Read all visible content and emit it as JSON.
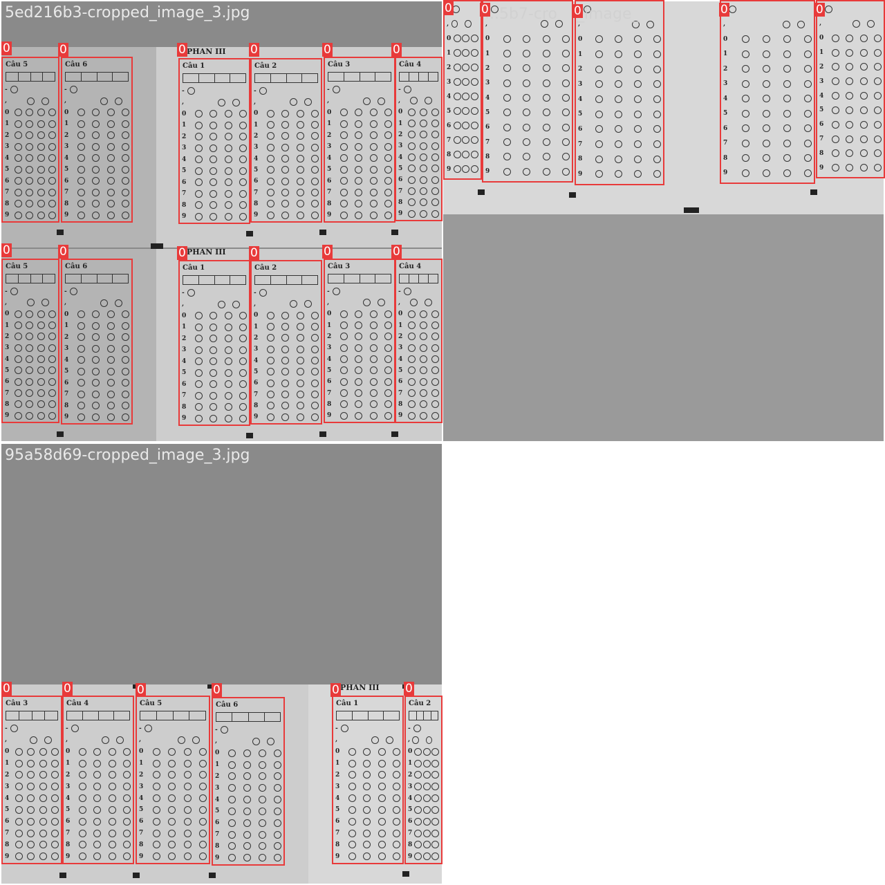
{
  "tiles": [
    {
      "title": "5ed216b3-cropped_image_3.jpg"
    },
    {
      "title": ""
    },
    {
      "title": "95a58d69-cropped_image_3.jpg"
    }
  ],
  "detection_label": "0",
  "header_label": "PHAN III",
  "columns": [
    "Câu 1",
    "Câu 2",
    "Câu 3",
    "Câu 4",
    "Câu 5",
    "Câu 6"
  ],
  "row_digits": [
    "0",
    "1",
    "2",
    "3",
    "4",
    "5",
    "6",
    "7",
    "8",
    "9"
  ],
  "symbols": {
    "minus": "-",
    "comma": ","
  },
  "colors": {
    "box": "#e83a3a",
    "background": "#9a9a9a",
    "sheet": "#cdcdcd"
  }
}
